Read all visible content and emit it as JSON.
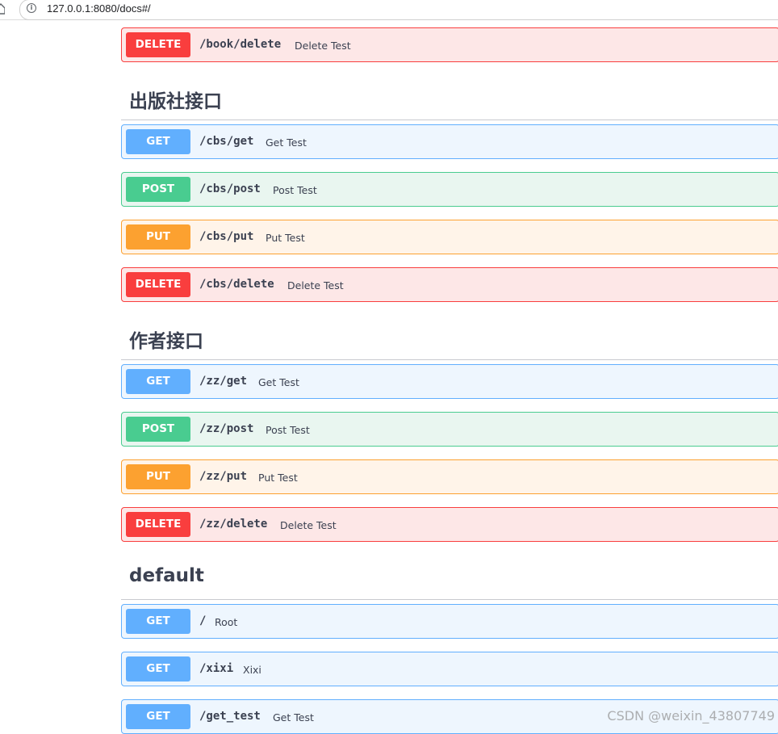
{
  "browser": {
    "url": "127.0.0.1:8080/docs#/",
    "info_icon": "i",
    "home_icon": "home-icon"
  },
  "sections": [
    {
      "operations": [
        {
          "method": "DELETE",
          "path": "/book/delete",
          "summary": "Delete Test",
          "kind": "delete"
        }
      ]
    },
    {
      "title": "出版社接口",
      "operations": [
        {
          "method": "GET",
          "path": "/cbs/get",
          "summary": "Get Test",
          "kind": "get"
        },
        {
          "method": "POST",
          "path": "/cbs/post",
          "summary": "Post Test",
          "kind": "post"
        },
        {
          "method": "PUT",
          "path": "/cbs/put",
          "summary": "Put Test",
          "kind": "put"
        },
        {
          "method": "DELETE",
          "path": "/cbs/delete",
          "summary": "Delete Test",
          "kind": "delete"
        }
      ]
    },
    {
      "title": "作者接口",
      "operations": [
        {
          "method": "GET",
          "path": "/zz/get",
          "summary": "Get Test",
          "kind": "get"
        },
        {
          "method": "POST",
          "path": "/zz/post",
          "summary": "Post Test",
          "kind": "post"
        },
        {
          "method": "PUT",
          "path": "/zz/put",
          "summary": "Put Test",
          "kind": "put"
        },
        {
          "method": "DELETE",
          "path": "/zz/delete",
          "summary": "Delete Test",
          "kind": "delete"
        }
      ]
    },
    {
      "title": "default",
      "operations": [
        {
          "method": "GET",
          "path": "/",
          "summary": "Root",
          "kind": "get"
        },
        {
          "method": "GET",
          "path": "/xixi",
          "summary": "Xixi",
          "kind": "get"
        },
        {
          "method": "GET",
          "path": "/get_test",
          "summary": "Get Test",
          "kind": "get"
        }
      ]
    }
  ],
  "watermark": "CSDN @weixin_43807749",
  "colors": {
    "get": "#61affe",
    "post": "#49cc90",
    "put": "#fca130",
    "delete": "#f93e3e",
    "text": "#3b4151"
  }
}
